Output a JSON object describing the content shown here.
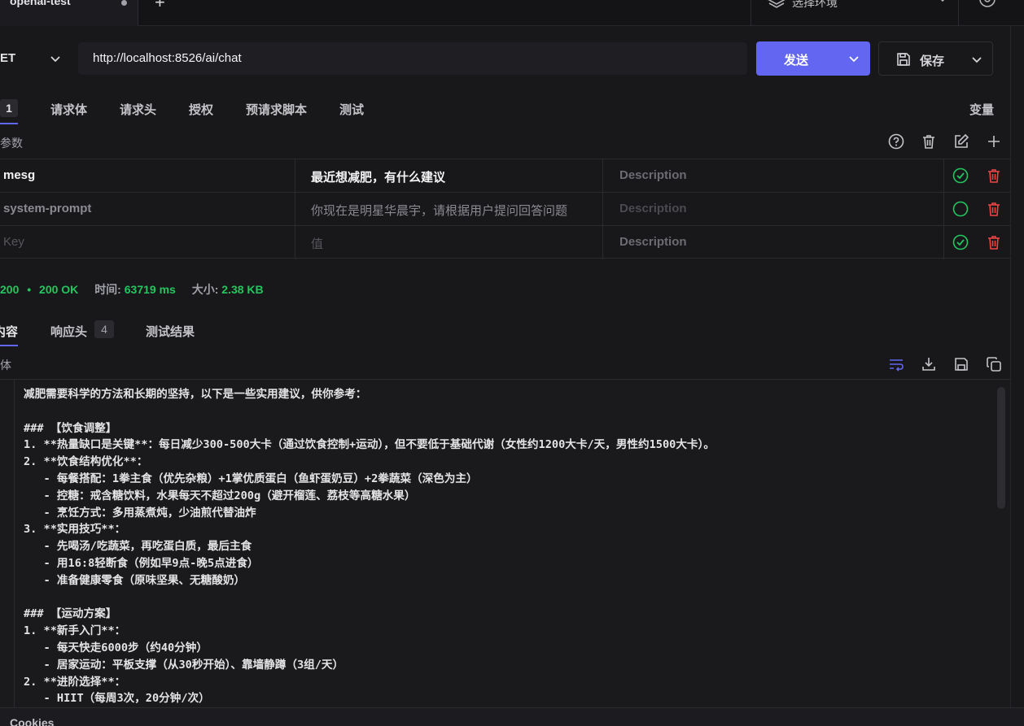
{
  "tabs": {
    "active_label": "openai-test",
    "env_label": "选择环境"
  },
  "request": {
    "method": "ET",
    "url": "http://localhost:8526/ai/chat",
    "send_label": "发送",
    "save_label": "保存"
  },
  "req_tabs": {
    "badge": "1",
    "body": "请求体",
    "headers": "请求头",
    "auth": "授权",
    "prescript": "预请求脚本",
    "test": "测试",
    "variables": "变量"
  },
  "params": {
    "label": "参数",
    "rows": [
      {
        "key": "mesg",
        "value": "最近想减肥，有什么建议",
        "desc": "Description",
        "enabled": true
      },
      {
        "key": "system-prompt",
        "value": "你现在是明星华晨宇，请根据用户提问回答问题",
        "desc": "Description",
        "enabled": false
      },
      {
        "key": "Key",
        "value": "值",
        "desc": "Description",
        "enabled": true
      }
    ]
  },
  "status": {
    "code": "200",
    "sep": "•",
    "text": "200 OK",
    "time_label": "时间:",
    "time_value": "63719 ms",
    "size_label": "大小:",
    "size_value": "2.38 KB"
  },
  "res_tabs": {
    "content": "内容",
    "headers": "响应头",
    "headers_count": "4",
    "tests": "测试结果"
  },
  "body_label": "体",
  "response_lines": [
    "减肥需要科学的方法和长期的坚持，以下是一些实用建议，供你参考：",
    "",
    "### 【饮食调整】",
    "1. **热量缺口是关键**：每日减少300-500大卡（通过饮食控制+运动），但不要低于基础代谢（女性约1200大卡/天，男性约1500大卡）。",
    "2. **饮食结构优化**：",
    "   - 每餐搭配：1拳主食（优先杂粮）+1掌优质蛋白（鱼虾蛋奶豆）+2拳蔬菜（深色为主）",
    "   - 控糖：戒含糖饮料，水果每天不超过200g（避开榴莲、荔枝等高糖水果）",
    "   - 烹饪方式：多用蒸煮炖，少油煎代替油炸",
    "3. **实用技巧**：",
    "   - 先喝汤/吃蔬菜，再吃蛋白质，最后主食",
    "   - 用16:8轻断食（例如早9点-晚5点进食）",
    "   - 准备健康零食（原味坚果、无糖酸奶）",
    "",
    "### 【运动方案】",
    "1. **新手入门**：",
    "   - 每天快走6000步（约40分钟）",
    "   - 居家运动：平板支撑（从30秒开始）、靠墙静蹲（3组/天）",
    "2. **进阶选择**：",
    "   - HIIT（每周3次，20分钟/次）"
  ],
  "footer": {
    "cookies_label": "Cookies"
  },
  "colors": {
    "accent": "#6366f1",
    "success": "#22c55e",
    "danger": "#ef4444"
  },
  "icons": [
    "layers-icon",
    "settings-icon",
    "help-icon",
    "trash-icon",
    "edit-icon",
    "plus-icon",
    "check-circle-icon",
    "circle-icon",
    "wrap-icon",
    "download-icon",
    "save-icon",
    "copy-icon"
  ]
}
